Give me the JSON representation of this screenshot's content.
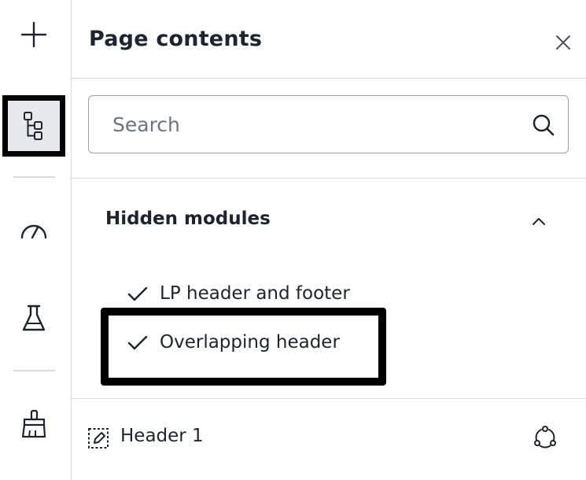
{
  "rail": {
    "items": [
      {
        "icon": "plus-icon"
      },
      {
        "icon": "tree-structure-icon",
        "active": true
      },
      {
        "icon": "speedometer-icon"
      },
      {
        "icon": "flask-icon"
      },
      {
        "icon": "paint-brush-icon"
      }
    ]
  },
  "panel": {
    "title": "Page contents",
    "close_icon": "close-icon"
  },
  "search": {
    "placeholder": "Search",
    "value": ""
  },
  "section": {
    "title": "Hidden modules",
    "expanded": true,
    "items": [
      {
        "label": "LP header and footer",
        "checked": true
      },
      {
        "label": "Overlapping header",
        "checked": true
      }
    ]
  },
  "footer": {
    "label": "Header 1",
    "icon": "edit-module-icon",
    "action_icon": "sync-icon"
  },
  "colors": {
    "text": "#1b2430",
    "border": "#d6dadf",
    "highlight": "#000000",
    "active_bg": "#e6e8eb"
  }
}
